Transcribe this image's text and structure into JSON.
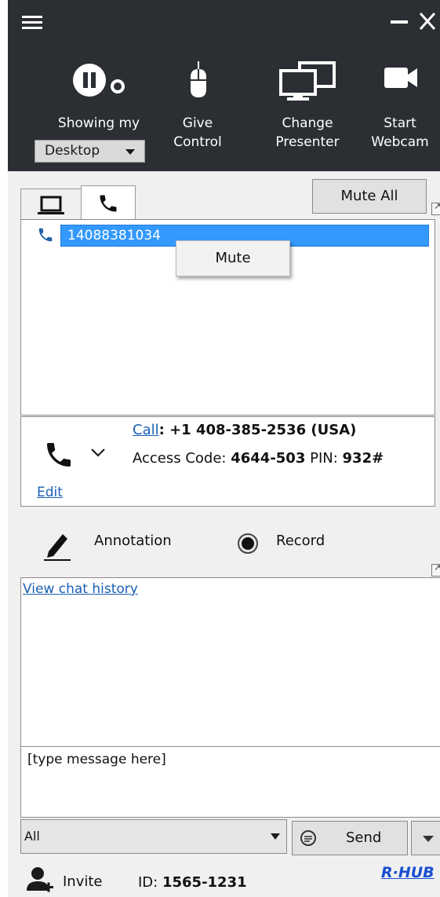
{
  "toolbar": {
    "showing": {
      "label": "Showing my",
      "selected": "Desktop"
    },
    "give_control": {
      "line1": "Give",
      "line2": "Control"
    },
    "change_presenter": {
      "line1": "Change",
      "line2": "Presenter"
    },
    "start_webcam": {
      "line1": "Start",
      "line2": "Webcam"
    }
  },
  "participants": {
    "tabs": [
      {
        "icon": "laptop-icon",
        "active": false
      },
      {
        "icon": "phone-icon",
        "active": true
      }
    ],
    "mute_all_label": "Mute All",
    "items": [
      {
        "icon": "phone-icon",
        "number": "14088381034",
        "selected": true
      }
    ],
    "context_menu": {
      "items": [
        "Mute"
      ]
    }
  },
  "dial_in": {
    "call_link": "Call",
    "call_number": ": +1 408-385-2536 (USA)",
    "access_code_label": "Access Code: ",
    "access_code": "4644-503",
    "pin_label": " PIN: ",
    "pin": "932#",
    "edit_link": "Edit"
  },
  "tools": {
    "annotation_label": "Annotation",
    "record_label": "Record"
  },
  "chat": {
    "history_link": "View chat history",
    "input_placeholder": "[type message here]",
    "recipient": "All",
    "send_label": "Send"
  },
  "footer": {
    "invite_label": "Invite",
    "id_label": "ID: ",
    "id_value": "1565-1231",
    "brand": "R·HUB"
  },
  "colors": {
    "toolbar_bg": "#2b2e33",
    "selection_bg": "#3399ff",
    "link": "#1a5fb4",
    "phone_icon": "#1f5fa8",
    "brand": "#1a4fd1"
  }
}
